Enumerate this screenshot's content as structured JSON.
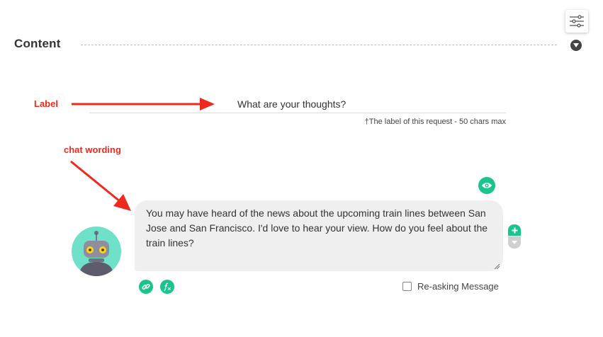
{
  "section": {
    "title": "Content"
  },
  "annotations": {
    "label_note": "Label",
    "chat_note": "chat wording",
    "arrow_color": "#ee2a1e"
  },
  "label_field": {
    "value": "What are your thoughts?",
    "hint": "†The label of this request - 50 chars max"
  },
  "chat": {
    "message": "You may have heard of the news about the upcoming train lines between San Jose and San Francisco. I'd love to hear your view. How do you feel about the train lines?",
    "reask_label": "Re-asking Message"
  },
  "icons": {
    "settings": "sliders-icon",
    "collapse": "chevron-down-icon",
    "preview": "eye-icon",
    "avatar": "robot-icon",
    "add": "plus-icon",
    "move": "chevron-down-icon",
    "link": "link-icon",
    "formula": "fx-icon"
  },
  "colors": {
    "accent": "#19c58c",
    "avatar_bg": "#6fe1c8",
    "bubble_bg": "#efefef"
  }
}
